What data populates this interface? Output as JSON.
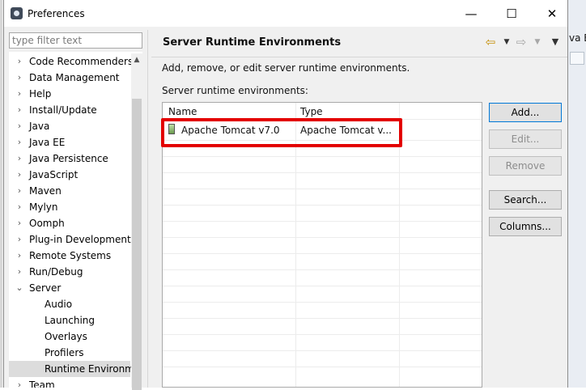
{
  "background": {
    "fragment_text": "va E"
  },
  "window": {
    "title": "Preferences"
  },
  "titlebar": {
    "minimize": "—",
    "maximize": "☐",
    "close": "✕"
  },
  "filter": {
    "placeholder": "type filter text",
    "value": ""
  },
  "tree": {
    "items": [
      {
        "label": "Code Recommenders",
        "expanded": false
      },
      {
        "label": "Data Management",
        "expanded": false
      },
      {
        "label": "Help",
        "expanded": false
      },
      {
        "label": "Install/Update",
        "expanded": false
      },
      {
        "label": "Java",
        "expanded": false
      },
      {
        "label": "Java EE",
        "expanded": false
      },
      {
        "label": "Java Persistence",
        "expanded": false
      },
      {
        "label": "JavaScript",
        "expanded": false
      },
      {
        "label": "Maven",
        "expanded": false
      },
      {
        "label": "Mylyn",
        "expanded": false
      },
      {
        "label": "Oomph",
        "expanded": false
      },
      {
        "label": "Plug-in Development",
        "expanded": false
      },
      {
        "label": "Remote Systems",
        "expanded": false
      },
      {
        "label": "Run/Debug",
        "expanded": false
      },
      {
        "label": "Server",
        "expanded": true
      },
      {
        "label": "Audio",
        "child": true
      },
      {
        "label": "Launching",
        "child": true
      },
      {
        "label": "Overlays",
        "child": true
      },
      {
        "label": "Profilers",
        "child": true
      },
      {
        "label": "Runtime Environm",
        "child": true,
        "selected": true
      },
      {
        "label": "Team",
        "expanded": false
      }
    ]
  },
  "page": {
    "title": "Server Runtime Environments",
    "description": "Add, remove, or edit server runtime environments.",
    "table_label": "Server runtime environments:",
    "columns": [
      "Name",
      "Type"
    ],
    "rows": [
      {
        "name": "Apache Tomcat v7.0",
        "type": "Apache Tomcat v...",
        "icon": "server-runtime-icon"
      }
    ]
  },
  "buttons": {
    "add": "Add...",
    "edit": "Edit...",
    "remove": "Remove",
    "search": "Search...",
    "columns": "Columns..."
  },
  "colors": {
    "highlight": "#e30000",
    "primary_border": "#0078d7",
    "back_arrow": "#c58f08"
  },
  "icons": {
    "back": "back-arrow-icon",
    "forward": "forward-arrow-icon",
    "view_menu": "view-menu-icon",
    "app": "eclipse-preferences-icon"
  }
}
